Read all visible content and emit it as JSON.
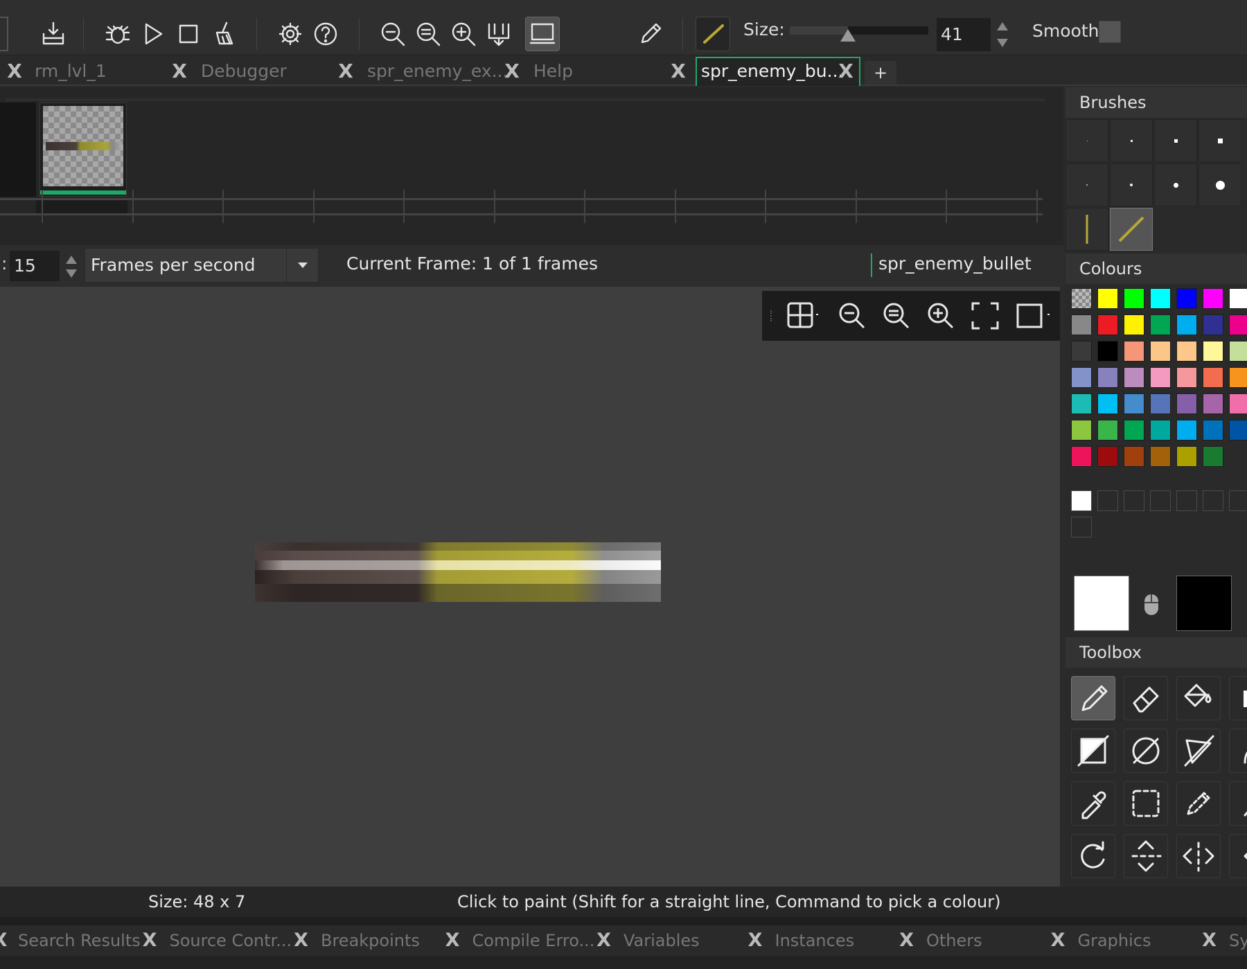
{
  "toolbar": {
    "size_label": "Size:",
    "size_value": "41",
    "size_slider_fraction": 0.42,
    "smooth_label": "Smooth",
    "smooth_checked": false
  },
  "tabs": [
    {
      "label": "rm_lvl_1",
      "active": false
    },
    {
      "label": "Debugger",
      "active": false
    },
    {
      "label": "spr_enemy_ex...",
      "active": false
    },
    {
      "label": "Help",
      "active": false
    },
    {
      "label": "spr_enemy_bu...",
      "active": true
    }
  ],
  "tab_add": "+",
  "frame_bar": {
    "speed_value": "15",
    "speed_unit": "Frames per second",
    "current_frame": "Current Frame: 1 of 1 frames",
    "sprite_name": "spr_enemy_bullet"
  },
  "panel": {
    "brushes_title": "Brushes",
    "colours_title": "Colours",
    "toolbox_title": "Toolbox"
  },
  "colours": {
    "row1": [
      "checker",
      "#ffff00",
      "#00ff00",
      "#00ffff",
      "#0000ff",
      "#ff00ff",
      "#ffffff"
    ],
    "row2": [
      "#888888",
      "#ed1c24",
      "#fff200",
      "#00a651",
      "#00aeef",
      "#2e3192",
      "#ec008c"
    ],
    "row3": [
      "#3a3a3a",
      "#000000",
      "#f69679",
      "#fdc689",
      "#fdc68a",
      "#fff799",
      "#c4df9b"
    ],
    "row4": [
      "#8393ca",
      "#8781bd",
      "#bd8cbf",
      "#f49ac1",
      "#f5989d",
      "#f26c4f",
      "#f7941d"
    ],
    "row5": [
      "#1cbbb4",
      "#00bff3",
      "#448ccb",
      "#5574b9",
      "#8560a8",
      "#a864a8",
      "#f06eaa"
    ],
    "row6": [
      "#8dc63f",
      "#39b54a",
      "#00a651",
      "#00a99d",
      "#00aeef",
      "#0072bc",
      "#0054a6"
    ],
    "row7": [
      "#ed145b",
      "#9e0b0f",
      "#a0410d",
      "#a36209",
      "#aba000",
      "#197b30"
    ],
    "custom_first": "#ffffff",
    "primary": "#ffffff",
    "secondary": "#000000"
  },
  "status": {
    "size": "Size: 48 x 7",
    "hint": "Click to paint (Shift for a straight line, Command to pick a colour)"
  },
  "bottom_tabs": [
    "Search Results",
    "Source Contr...",
    "Breakpoints",
    "Compile Erro...",
    "Variables",
    "Instances",
    "Others",
    "Graphics",
    "Sy"
  ]
}
